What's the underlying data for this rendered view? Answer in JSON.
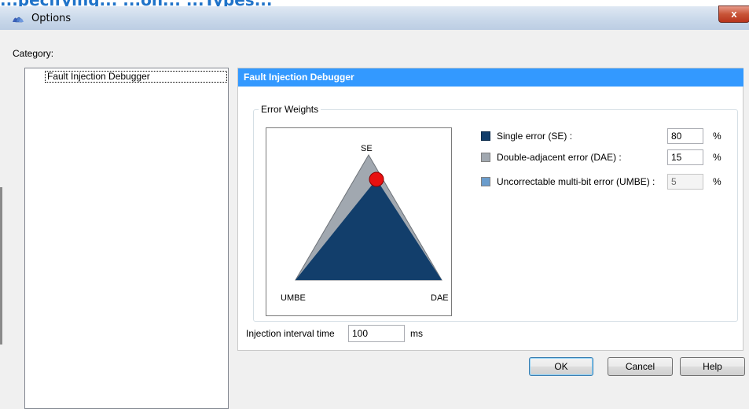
{
  "background_banner_text": "...pecifying... ...on... ...Types...",
  "window": {
    "title": "Options",
    "close_label": "x"
  },
  "category_label": "Category:",
  "tree": {
    "items": [
      "Fault Injection Debugger"
    ]
  },
  "panel": {
    "header": "Fault Injection Debugger",
    "group_title": "Error Weights",
    "triangle_labels": {
      "top": "SE",
      "bottom_left": "UMBE",
      "bottom_right": "DAE"
    },
    "weights": [
      {
        "label": "Single error (SE) :",
        "value": "80",
        "unit": "%",
        "color": "#123e6b",
        "enabled": true
      },
      {
        "label": "Double-adjacent error (DAE) :",
        "value": "15",
        "unit": "%",
        "color": "#a1a8b0",
        "enabled": true
      },
      {
        "label": "Uncorrectable multi-bit error (UMBE) :",
        "value": "5",
        "unit": "%",
        "color": "#6a9ccc",
        "enabled": false
      }
    ],
    "interval": {
      "label": "Injection interval time",
      "value": "100",
      "unit": "ms"
    }
  },
  "buttons": {
    "ok": "OK",
    "cancel": "Cancel",
    "help": "Help"
  },
  "colors": {
    "header_blue": "#3399ff",
    "se_region": "#123e6b",
    "dae_region": "#a1a8b0",
    "umbe_region": "#6a9ccc",
    "marker": "#e81010"
  }
}
